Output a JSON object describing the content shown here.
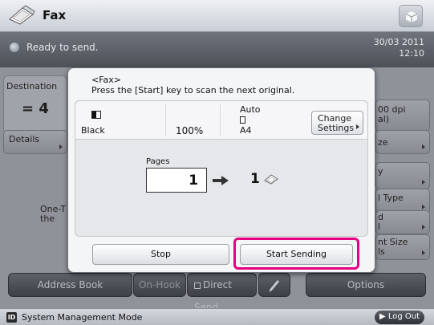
{
  "header": {
    "title": "Fax"
  },
  "status": {
    "text": "Ready to send.",
    "date": "30/03 2011",
    "time": "12:10"
  },
  "background": {
    "destination_label": "Destination",
    "destination_count": "= 4",
    "details_label": "Details",
    "one_touch_line1": "One-T",
    "one_touch_line2": "the",
    "resolution_line1": "00 dpi",
    "resolution_line2": "al)",
    "size_label": "ze",
    "right_item_1": "y",
    "right_item_2": "l Type",
    "right_item_3_line1": "d",
    "right_item_3_line2": "l",
    "right_item_4_line1": "nt Size",
    "right_item_4_line2": "ls"
  },
  "bottom": {
    "address_book": "Address Book",
    "on_hook": "On-Hook",
    "direct_send": "Direct Send",
    "options": "Options"
  },
  "system_bar": {
    "id_badge": "ID",
    "mode_text": "System Management Mode",
    "logout": "Log Out"
  },
  "dialog": {
    "title": "<Fax>",
    "message": "Press the [Start] key to scan the next original.",
    "color_mode": "Black",
    "scale": "100%",
    "size_auto": "Auto",
    "size": "A4",
    "change_settings_line1": "Change",
    "change_settings_line2": "Settings",
    "pages_label": "Pages",
    "pages_total": "1",
    "pages_current": "1",
    "stop": "Stop",
    "start_sending": "Start Sending"
  },
  "colors": {
    "highlight": "#e4007f"
  }
}
